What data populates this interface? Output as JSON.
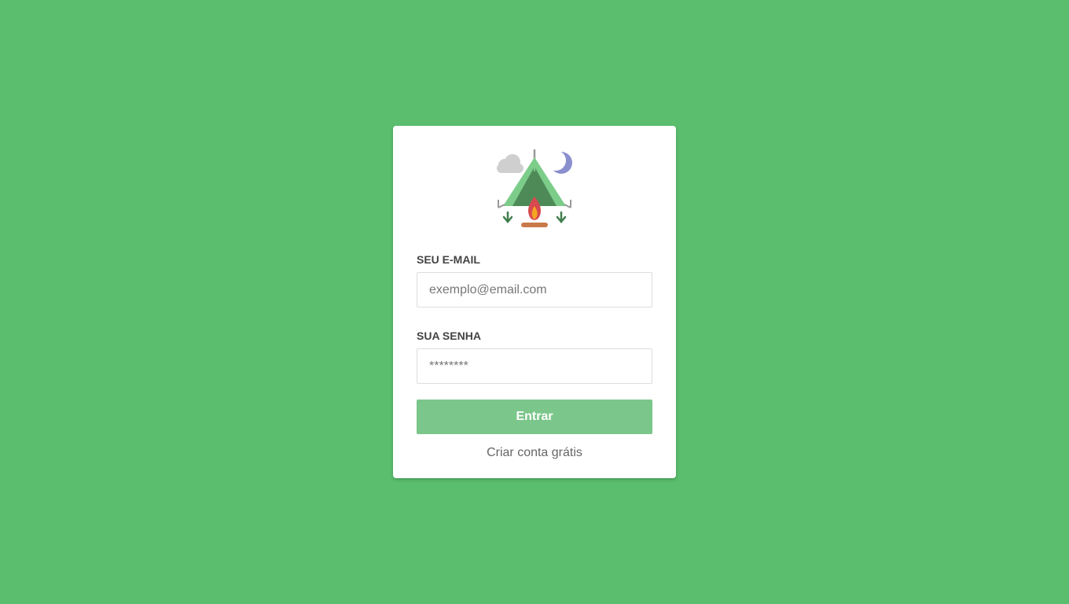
{
  "login": {
    "email_label": "SEU E-MAIL",
    "email_placeholder": "exemplo@email.com",
    "password_label": "SUA SENHA",
    "password_placeholder": "********",
    "submit_label": "Entrar",
    "signup_link": "Criar conta grátis"
  },
  "colors": {
    "background": "#5abe6e",
    "button": "#7bc68a"
  },
  "icons": {
    "logo": "camping-tent-icon"
  }
}
